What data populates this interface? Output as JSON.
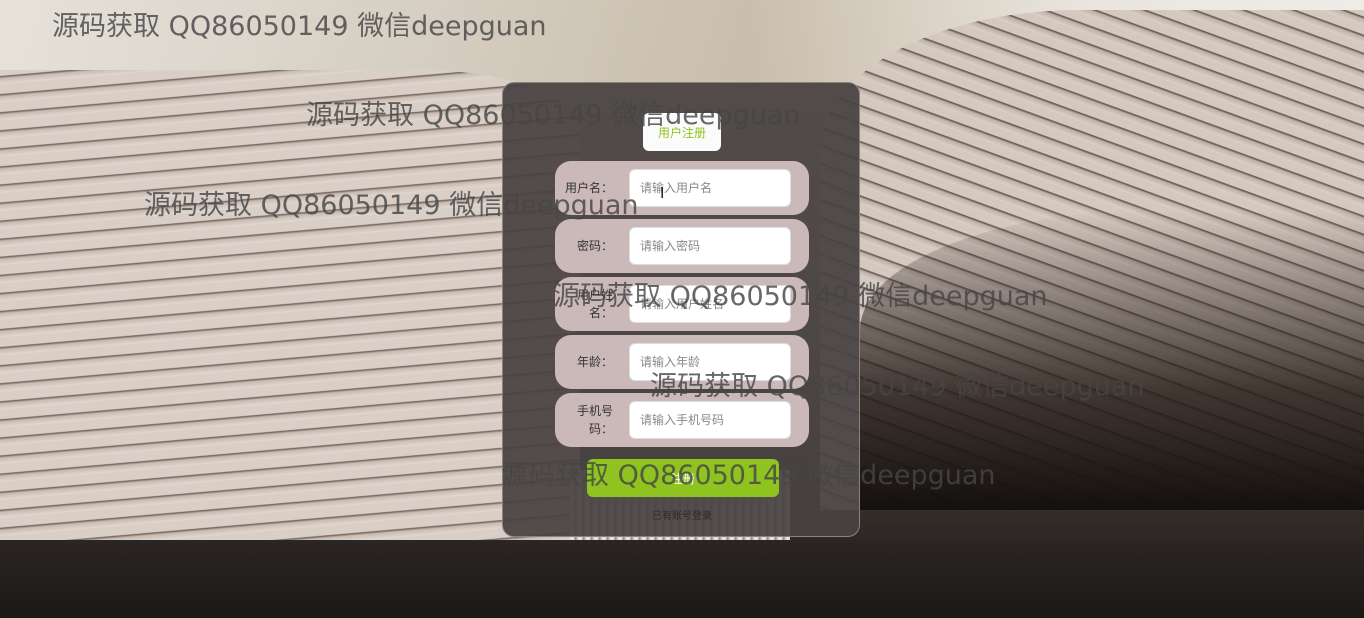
{
  "form": {
    "title": "用户注册",
    "fields": [
      {
        "label": "用户名：",
        "placeholder": "请输入用户名"
      },
      {
        "label": "密码：",
        "placeholder": "请输入密码"
      },
      {
        "label": "用户姓名：",
        "placeholder": "请输入用户姓名"
      },
      {
        "label": "年龄：",
        "placeholder": "请输入年龄"
      },
      {
        "label": "手机号码：",
        "placeholder": "请输入手机号码"
      }
    ],
    "submit_label": "注册",
    "login_link": "已有账号登录"
  },
  "watermark": {
    "text": "源码获取 QQ86050149 微信deepguan"
  },
  "colors": {
    "accent": "#8fc31f",
    "panel": "#484242",
    "row_bg": "#cbb8b9"
  },
  "icons": {
    "cursor": "text-cursor-icon"
  }
}
